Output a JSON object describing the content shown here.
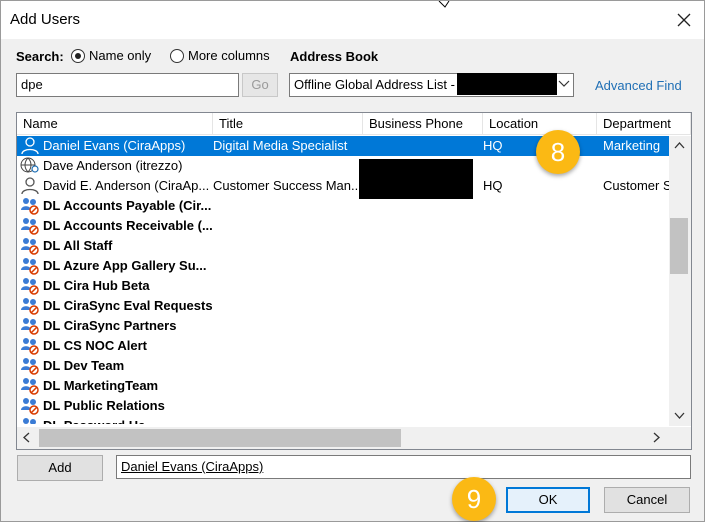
{
  "window": {
    "title": "Add Users"
  },
  "search": {
    "label": "Search:",
    "option_name_only": "Name only",
    "option_more_columns": "More columns",
    "selected": "Name only",
    "value": "dpe",
    "go_label": "Go"
  },
  "address_book": {
    "label": "Address Book",
    "selected": "Offline Global Address List -",
    "advanced_find": "Advanced Find"
  },
  "columns": [
    "Name",
    "Title",
    "Business Phone",
    "Location",
    "Department"
  ],
  "rows": [
    {
      "name": "Daniel Evans (CiraApps)",
      "title": "Digital Media Specialist",
      "phone": "",
      "location": "HQ",
      "department": "Marketing",
      "icon": "user-icon",
      "selected": true
    },
    {
      "name": "Dave Anderson (itrezzo)",
      "title": "",
      "phone": "",
      "location": "",
      "department": "",
      "icon": "external-contact-icon"
    },
    {
      "name": "David E. Anderson (CiraAp...",
      "title": "Customer Success Man...",
      "phone": "",
      "location": "HQ",
      "department": "Customer S",
      "icon": "user-icon"
    },
    {
      "name": "DL Accounts Payable (Cir...",
      "title": "",
      "phone": "",
      "location": "",
      "department": "",
      "icon": "distribution-list-icon"
    },
    {
      "name": "DL Accounts Receivable (...",
      "title": "",
      "phone": "",
      "location": "",
      "department": "",
      "icon": "distribution-list-icon"
    },
    {
      "name": "DL All Staff",
      "title": "",
      "phone": "",
      "location": "",
      "department": "",
      "icon": "distribution-list-icon"
    },
    {
      "name": "DL Azure App Gallery Su...",
      "title": "",
      "phone": "",
      "location": "",
      "department": "",
      "icon": "distribution-list-icon"
    },
    {
      "name": "DL Cira Hub Beta",
      "title": "",
      "phone": "",
      "location": "",
      "department": "",
      "icon": "distribution-list-icon"
    },
    {
      "name": "DL CiraSync Eval Requests",
      "title": "",
      "phone": "",
      "location": "",
      "department": "",
      "icon": "distribution-list-icon"
    },
    {
      "name": "DL CiraSync Partners",
      "title": "",
      "phone": "",
      "location": "",
      "department": "",
      "icon": "distribution-list-icon"
    },
    {
      "name": "DL CS NOC Alert",
      "title": "",
      "phone": "",
      "location": "",
      "department": "",
      "icon": "distribution-list-icon"
    },
    {
      "name": "DL Dev Team",
      "title": "",
      "phone": "",
      "location": "",
      "department": "",
      "icon": "distribution-list-icon"
    },
    {
      "name": "DL MarketingTeam",
      "title": "",
      "phone": "",
      "location": "",
      "department": "",
      "icon": "distribution-list-icon"
    },
    {
      "name": "DL Public Relations",
      "title": "",
      "phone": "",
      "location": "",
      "department": "",
      "icon": "distribution-list-icon"
    },
    {
      "name": "DL Password Ha...",
      "title": "",
      "phone": "",
      "location": "",
      "department": "",
      "icon": "distribution-list-icon"
    }
  ],
  "add": {
    "button_label": "Add",
    "selected_value": "Daniel Evans (CiraApps)"
  },
  "buttons": {
    "ok": "OK",
    "cancel": "Cancel"
  },
  "badges": {
    "step_8": "8",
    "step_9": "9"
  },
  "colors": {
    "selection": "#0078d7",
    "link": "#1f6fb5",
    "badge": "#fbb914"
  }
}
